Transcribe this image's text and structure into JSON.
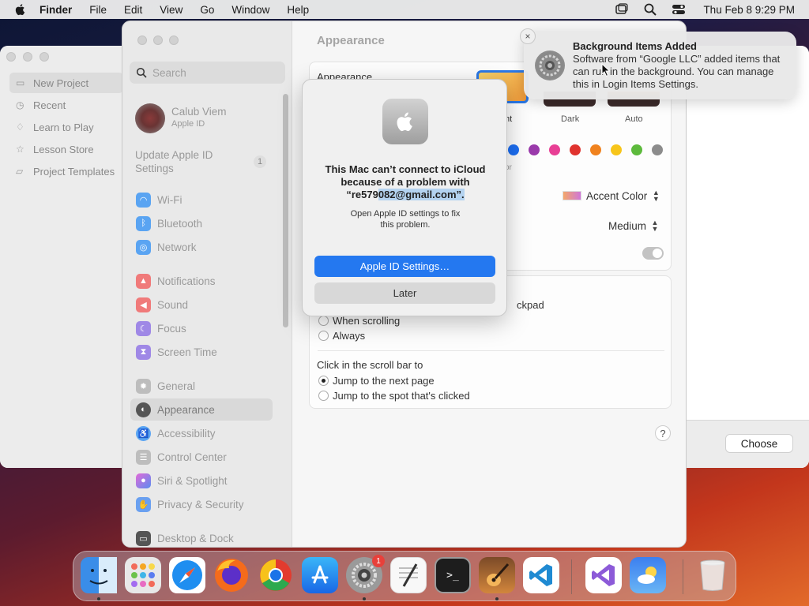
{
  "menubar": {
    "app_name": "Finder",
    "menus": [
      "File",
      "Edit",
      "View",
      "Go",
      "Window",
      "Help"
    ],
    "clock": "Thu Feb 8  9:29 PM"
  },
  "background_window": {
    "sidebar": [
      "New Project",
      "Recent",
      "Learn to Play",
      "Lesson Store",
      "Project Templates"
    ],
    "choose_label": "Choose"
  },
  "settings": {
    "search_placeholder": "Search",
    "user": {
      "name": "Calub Viem",
      "subtitle": "Apple ID"
    },
    "update": {
      "label": "Update Apple ID Settings",
      "badge": "1"
    },
    "sidebar_items": [
      {
        "label": "Wi-Fi",
        "color": "#5aa4f2",
        "icon": "wifi-icon"
      },
      {
        "label": "Bluetooth",
        "color": "#5aa4f2",
        "icon": "bluetooth-icon"
      },
      {
        "label": "Network",
        "color": "#5aa4f2",
        "icon": "globe-icon"
      },
      {
        "label": "Notifications",
        "color": "#f07a7a",
        "icon": "bell-icon"
      },
      {
        "label": "Sound",
        "color": "#f07a7a",
        "icon": "speaker-icon"
      },
      {
        "label": "Focus",
        "color": "#9f88e6",
        "icon": "moon-icon"
      },
      {
        "label": "Screen Time",
        "color": "#9f88e6",
        "icon": "hourglass-icon"
      },
      {
        "label": "General",
        "color": "#bdbdbd",
        "icon": "gear-icon"
      },
      {
        "label": "Appearance",
        "color": "#555555",
        "icon": "appearance-icon"
      },
      {
        "label": "Accessibility",
        "color": "#5aa4f2",
        "icon": "accessibility-icon"
      },
      {
        "label": "Control Center",
        "color": "#bdbdbd",
        "icon": "control-center-icon"
      },
      {
        "label": "Siri & Spotlight",
        "color": "#c27be0",
        "icon": "siri-icon"
      },
      {
        "label": "Privacy & Security",
        "color": "#6aa0f0",
        "icon": "hand-icon"
      },
      {
        "label": "Desktop & Dock",
        "color": "#555555",
        "icon": "dock-icon"
      }
    ],
    "selected": "Appearance",
    "content_title": "Appearance",
    "appearance_label": "Appearance",
    "theme_options": [
      "ht",
      "Dark",
      "Auto"
    ],
    "accent_colors": [
      "#1c6ef2",
      "#9a3aab",
      "#e83f95",
      "#e0332e",
      "#f0821e",
      "#f7c51a",
      "#5dba3c",
      "#8c8c8c"
    ],
    "accent_partial_label": "or",
    "highlight_color": "Accent Color",
    "sidebar_icon_size": "Medium",
    "scroll_partial_label": "ckpad",
    "scroll_options": [
      "When scrolling",
      "Always"
    ],
    "click_title": "Click in the scroll bar to",
    "click_options": [
      "Jump to the next page",
      "Jump to the spot that's clicked"
    ],
    "help": "?"
  },
  "alert": {
    "title_line1": "This Mac can’t connect to iCloud",
    "title_line2": "because of a problem with",
    "email_prefix": "“re579",
    "email_selected": "082@gmail.com”.",
    "message_line1": "Open Apple ID settings to fix",
    "message_line2": "this problem.",
    "primary_button": "Apple ID Settings…",
    "secondary_button": "Later"
  },
  "notification": {
    "title": "Background Items Added",
    "body": "Software from “Google LLC” added items that can run in the background. You can manage this in Login Items Settings.",
    "close": "×"
  },
  "dock": {
    "badge": "1"
  }
}
